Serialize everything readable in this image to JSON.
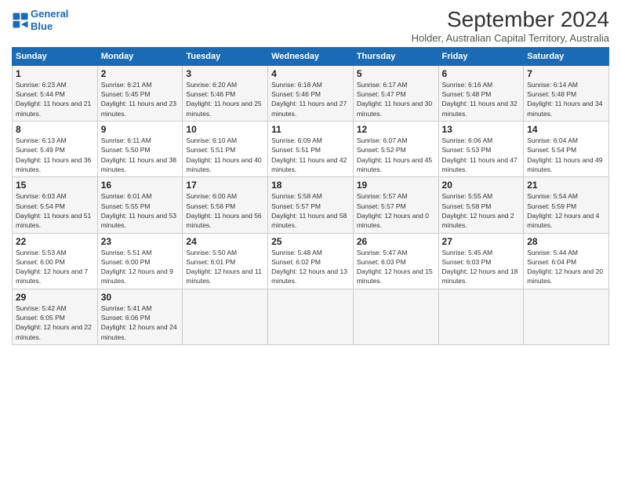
{
  "header": {
    "logo_line1": "General",
    "logo_line2": "Blue",
    "title": "September 2024",
    "subtitle": "Holder, Australian Capital Territory, Australia"
  },
  "days_of_week": [
    "Sunday",
    "Monday",
    "Tuesday",
    "Wednesday",
    "Thursday",
    "Friday",
    "Saturday"
  ],
  "weeks": [
    [
      {
        "day": "1",
        "sunrise": "6:23 AM",
        "sunset": "5:44 PM",
        "daylight": "11 hours and 21 minutes."
      },
      {
        "day": "2",
        "sunrise": "6:21 AM",
        "sunset": "5:45 PM",
        "daylight": "11 hours and 23 minutes."
      },
      {
        "day": "3",
        "sunrise": "6:20 AM",
        "sunset": "5:46 PM",
        "daylight": "11 hours and 25 minutes."
      },
      {
        "day": "4",
        "sunrise": "6:18 AM",
        "sunset": "5:46 PM",
        "daylight": "11 hours and 27 minutes."
      },
      {
        "day": "5",
        "sunrise": "6:17 AM",
        "sunset": "5:47 PM",
        "daylight": "11 hours and 30 minutes."
      },
      {
        "day": "6",
        "sunrise": "6:16 AM",
        "sunset": "5:48 PM",
        "daylight": "11 hours and 32 minutes."
      },
      {
        "day": "7",
        "sunrise": "6:14 AM",
        "sunset": "5:48 PM",
        "daylight": "11 hours and 34 minutes."
      }
    ],
    [
      {
        "day": "8",
        "sunrise": "6:13 AM",
        "sunset": "5:49 PM",
        "daylight": "11 hours and 36 minutes."
      },
      {
        "day": "9",
        "sunrise": "6:11 AM",
        "sunset": "5:50 PM",
        "daylight": "11 hours and 38 minutes."
      },
      {
        "day": "10",
        "sunrise": "6:10 AM",
        "sunset": "5:51 PM",
        "daylight": "11 hours and 40 minutes."
      },
      {
        "day": "11",
        "sunrise": "6:09 AM",
        "sunset": "5:51 PM",
        "daylight": "11 hours and 42 minutes."
      },
      {
        "day": "12",
        "sunrise": "6:07 AM",
        "sunset": "5:52 PM",
        "daylight": "11 hours and 45 minutes."
      },
      {
        "day": "13",
        "sunrise": "6:06 AM",
        "sunset": "5:53 PM",
        "daylight": "11 hours and 47 minutes."
      },
      {
        "day": "14",
        "sunrise": "6:04 AM",
        "sunset": "5:54 PM",
        "daylight": "11 hours and 49 minutes."
      }
    ],
    [
      {
        "day": "15",
        "sunrise": "6:03 AM",
        "sunset": "5:54 PM",
        "daylight": "11 hours and 51 minutes."
      },
      {
        "day": "16",
        "sunrise": "6:01 AM",
        "sunset": "5:55 PM",
        "daylight": "11 hours and 53 minutes."
      },
      {
        "day": "17",
        "sunrise": "6:00 AM",
        "sunset": "5:56 PM",
        "daylight": "11 hours and 56 minutes."
      },
      {
        "day": "18",
        "sunrise": "5:58 AM",
        "sunset": "5:57 PM",
        "daylight": "11 hours and 58 minutes."
      },
      {
        "day": "19",
        "sunrise": "5:57 AM",
        "sunset": "5:57 PM",
        "daylight": "12 hours and 0 minutes."
      },
      {
        "day": "20",
        "sunrise": "5:55 AM",
        "sunset": "5:58 PM",
        "daylight": "12 hours and 2 minutes."
      },
      {
        "day": "21",
        "sunrise": "5:54 AM",
        "sunset": "5:59 PM",
        "daylight": "12 hours and 4 minutes."
      }
    ],
    [
      {
        "day": "22",
        "sunrise": "5:53 AM",
        "sunset": "6:00 PM",
        "daylight": "12 hours and 7 minutes."
      },
      {
        "day": "23",
        "sunrise": "5:51 AM",
        "sunset": "6:00 PM",
        "daylight": "12 hours and 9 minutes."
      },
      {
        "day": "24",
        "sunrise": "5:50 AM",
        "sunset": "6:01 PM",
        "daylight": "12 hours and 11 minutes."
      },
      {
        "day": "25",
        "sunrise": "5:48 AM",
        "sunset": "6:02 PM",
        "daylight": "12 hours and 13 minutes."
      },
      {
        "day": "26",
        "sunrise": "5:47 AM",
        "sunset": "6:03 PM",
        "daylight": "12 hours and 15 minutes."
      },
      {
        "day": "27",
        "sunrise": "5:45 AM",
        "sunset": "6:03 PM",
        "daylight": "12 hours and 18 minutes."
      },
      {
        "day": "28",
        "sunrise": "5:44 AM",
        "sunset": "6:04 PM",
        "daylight": "12 hours and 20 minutes."
      }
    ],
    [
      {
        "day": "29",
        "sunrise": "5:42 AM",
        "sunset": "6:05 PM",
        "daylight": "12 hours and 22 minutes."
      },
      {
        "day": "30",
        "sunrise": "5:41 AM",
        "sunset": "6:06 PM",
        "daylight": "12 hours and 24 minutes."
      },
      null,
      null,
      null,
      null,
      null
    ]
  ]
}
